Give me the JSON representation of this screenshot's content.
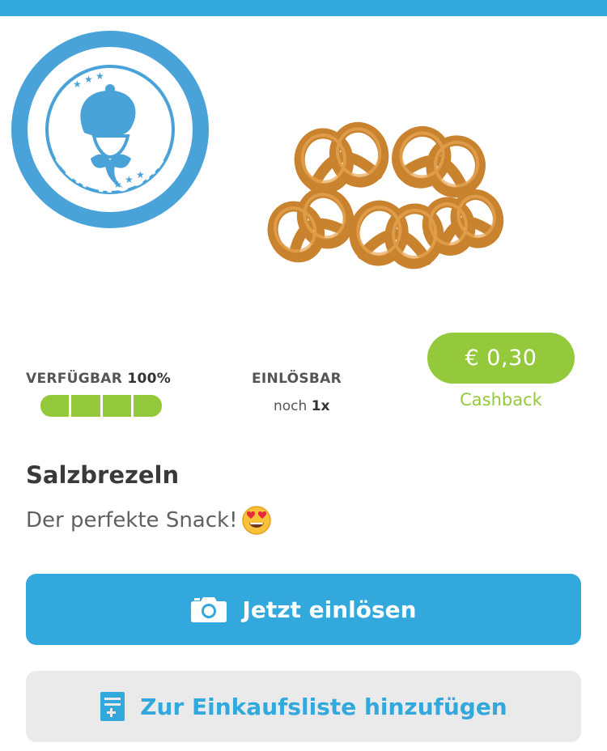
{
  "deal_badge": {
    "top_text": "MARKTGURU-DEAL",
    "bottom_text": "DER WOCHE",
    "icon": "guru-mascot-icon",
    "color": "#4aa3d8"
  },
  "product": {
    "image": "pretzels-image",
    "name": "Salzbrezeln",
    "description": "Der perfekte Snack!",
    "description_emoji": "heart-eyes-emoji"
  },
  "availability": {
    "label": "VERFÜGBAR",
    "value": "100%",
    "fraction": 1.0,
    "segments": 4
  },
  "redeemable": {
    "label": "EINLÖSBAR",
    "prefix": "noch",
    "count": "1x"
  },
  "cashback": {
    "amount": "€ 0,30",
    "label": "Cashback"
  },
  "actions": {
    "redeem_label": "Jetzt einlösen",
    "redeem_icon": "camera-icon",
    "list_label": "Zur Einkaufsliste hinzufügen",
    "list_icon": "shopping-list-icon"
  },
  "colors": {
    "primary": "#33a8dc",
    "accent_green": "#93c93b",
    "secondary_button_bg": "#eaeaea"
  }
}
